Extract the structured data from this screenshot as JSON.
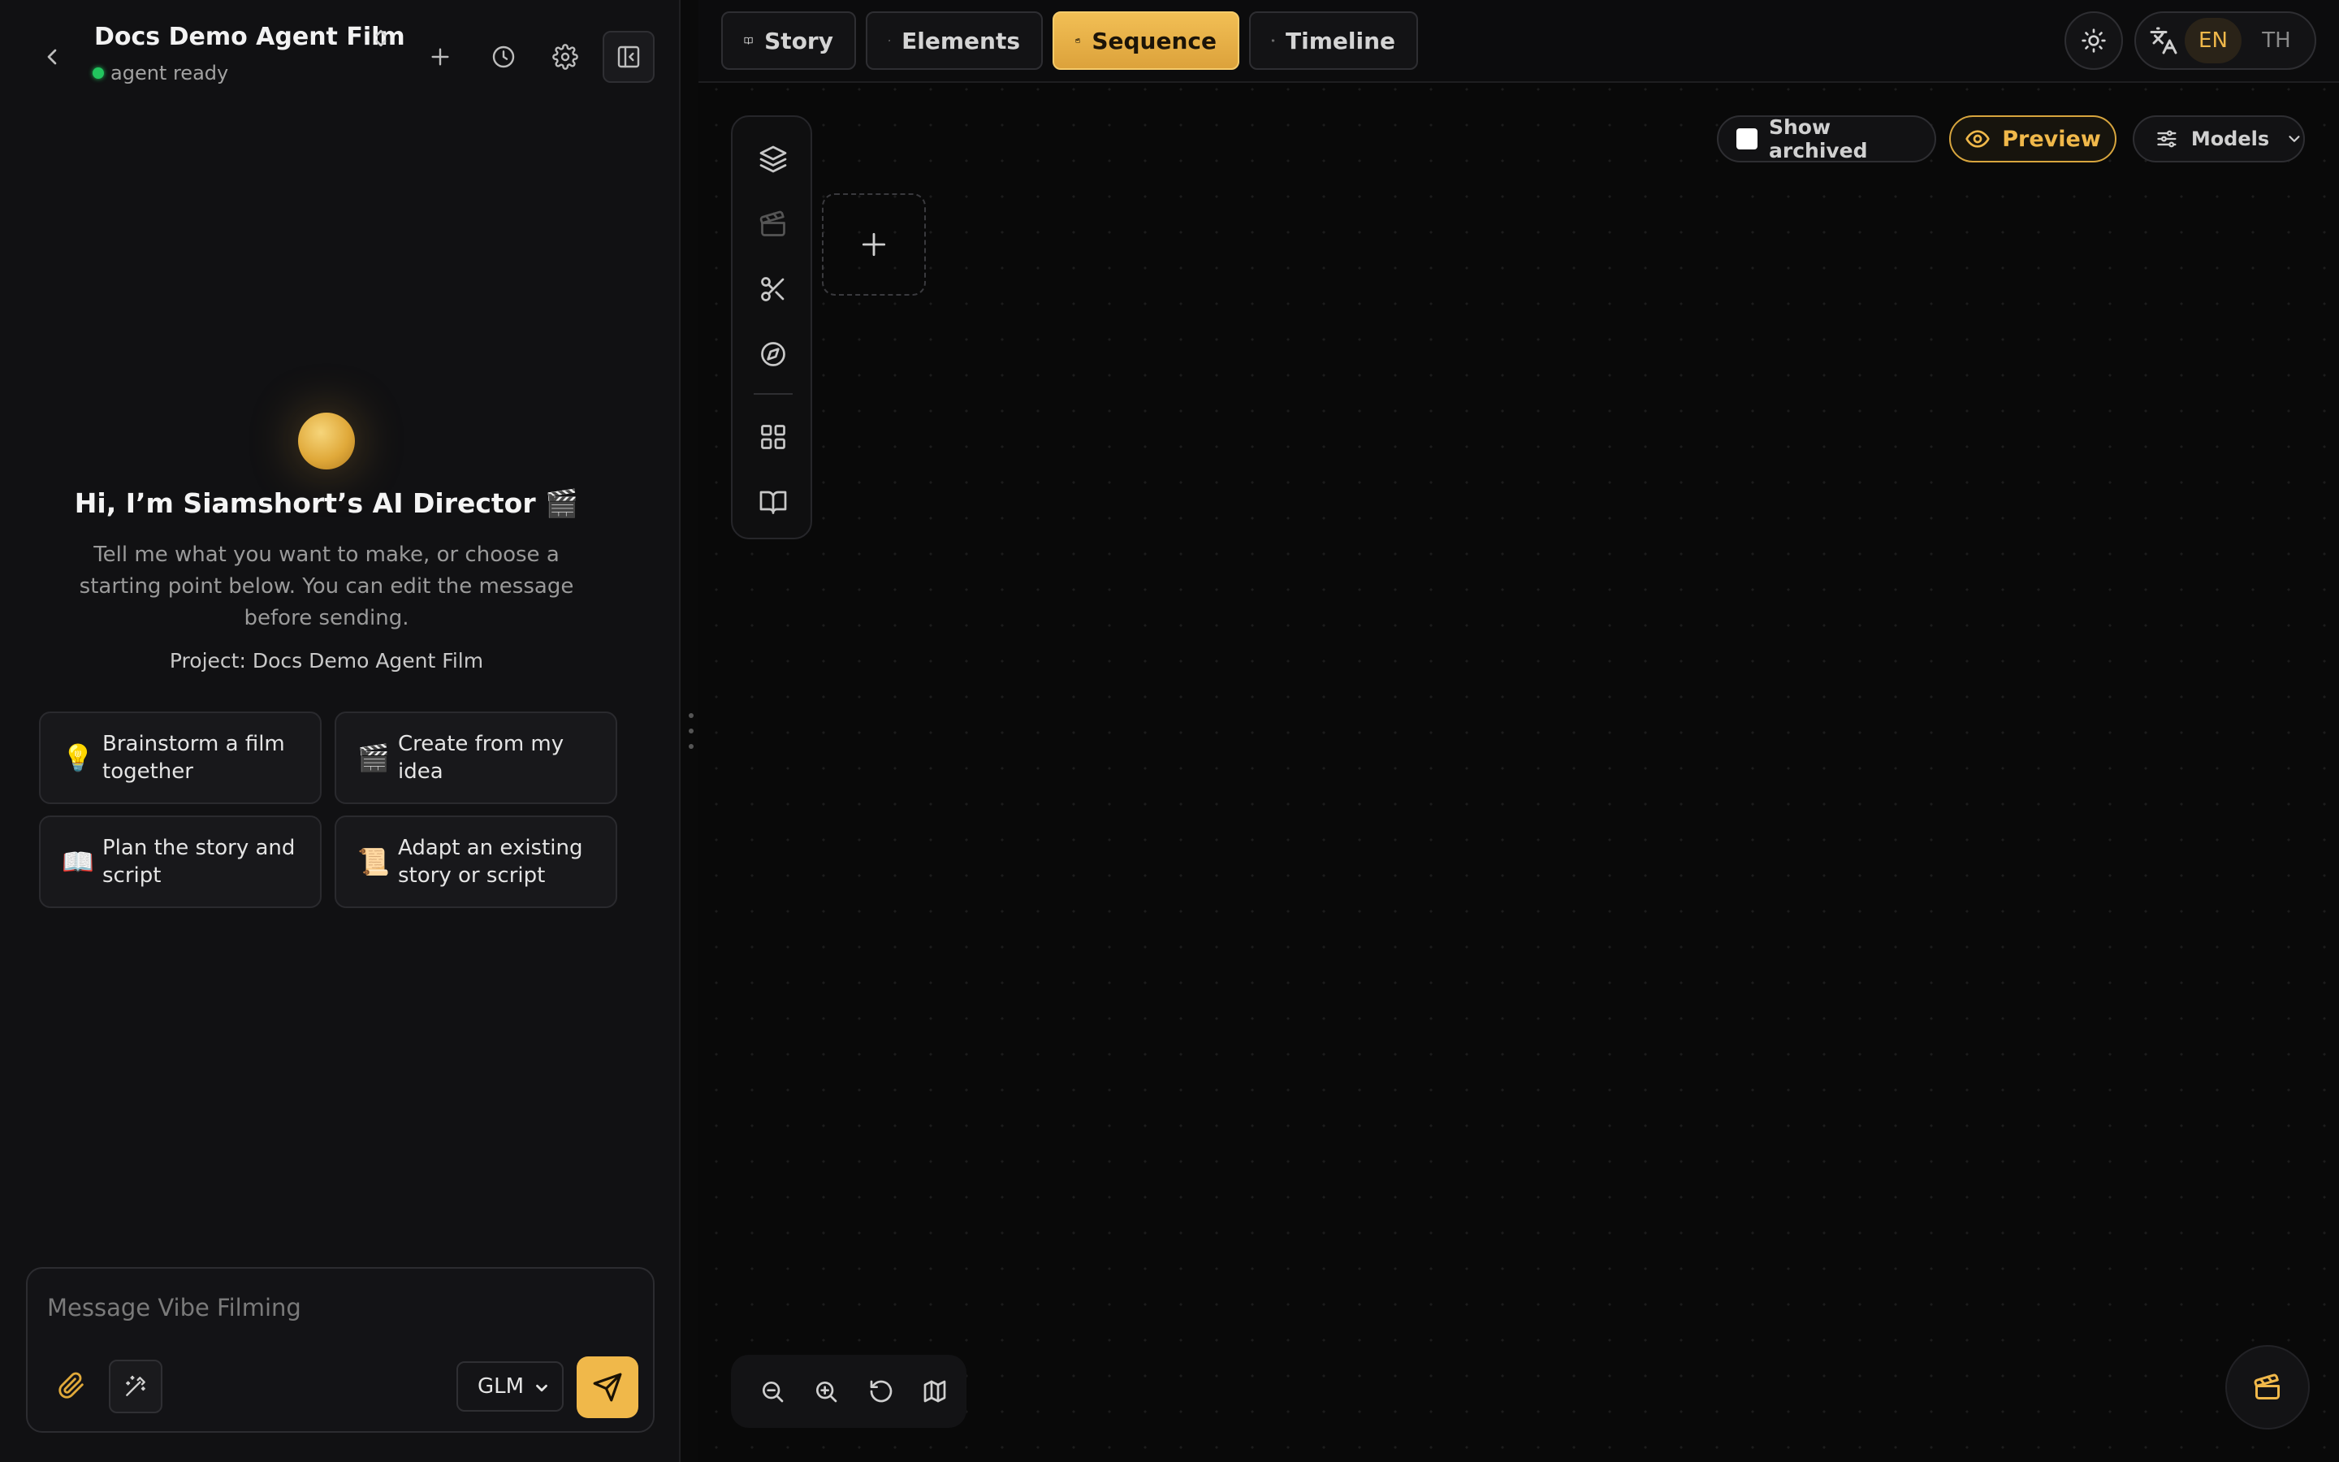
{
  "chat": {
    "project_title": "Docs Demo Agent Film",
    "status": "agent ready",
    "greeting": "Hi, I’m Siamshort’s AI Director 🎬",
    "intro": "Tell me what you want to make, or choose a starting point below. You can edit the message before sending.",
    "project_line": "Project: Docs Demo Agent Film",
    "suggestions": [
      {
        "emoji": "💡",
        "label": "Brainstorm a film together"
      },
      {
        "emoji": "🎬",
        "label": "Create from my idea"
      },
      {
        "emoji": "📖",
        "label": "Plan the story and script"
      },
      {
        "emoji": "📜",
        "label": "Adapt an existing story or script"
      }
    ],
    "composer": {
      "placeholder": "Message Vibe Filming",
      "model": "GLM"
    }
  },
  "workspace": {
    "tabs": [
      {
        "label": "Story",
        "icon": "book-open-icon"
      },
      {
        "label": "Elements",
        "icon": "image-edit-icon"
      },
      {
        "label": "Sequence",
        "icon": "clapperboard-icon",
        "active": true
      },
      {
        "label": "Timeline",
        "icon": "film-icon"
      }
    ],
    "languages": [
      "EN",
      "TH"
    ],
    "active_language": "EN",
    "show_archived_label": "Show archived",
    "show_archived_checked": false,
    "preview_label": "Preview",
    "models_label": "Models",
    "tool_rail": [
      "layers-icon",
      "clapperboard-icon",
      "scissors-icon",
      "compass-icon",
      "grid-icon",
      "book-open-icon"
    ],
    "zoom_controls": [
      "zoom-out-icon",
      "zoom-in-icon",
      "reset-icon",
      "map-icon"
    ]
  },
  "colors": {
    "accent": "#f0b84a",
    "status_ready": "#22c55e",
    "panel_bg": "#111113",
    "canvas_bg": "#090909"
  }
}
